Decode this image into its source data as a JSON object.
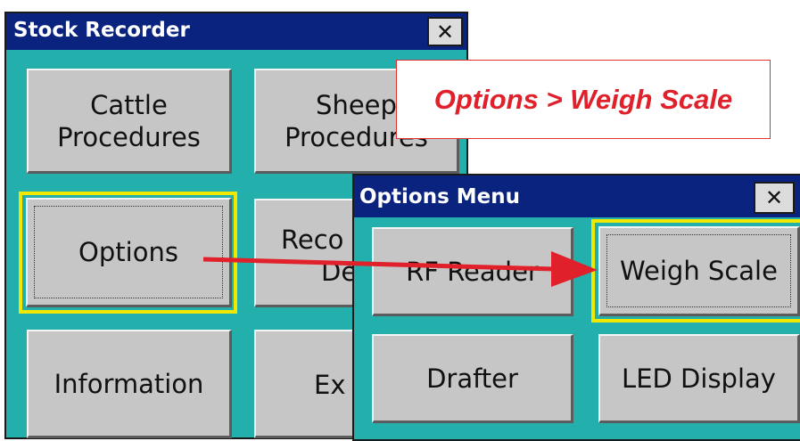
{
  "main_window": {
    "title": "Stock Recorder",
    "close_label": "✕",
    "buttons": {
      "cattle": {
        "line1": "Cattle",
        "line2": "Procedures"
      },
      "sheep": {
        "line1": "Sheep",
        "line2": "Procedures"
      },
      "options": "Options",
      "record_device": {
        "line1": "Reco",
        "line2": "Dev"
      },
      "information": "Information",
      "exit": "Ex"
    }
  },
  "options_window": {
    "title": "Options Menu",
    "close_label": "✕",
    "buttons": {
      "rf_reader": "RF Reader",
      "weigh_scale": "Weigh Scale",
      "drafter": "Drafter",
      "led_display": "LED Display"
    }
  },
  "callout": {
    "text": "Options > Weigh Scale"
  },
  "colors": {
    "titlebar": "#0a237e",
    "window_bg": "#23b0ac",
    "button_face": "#c6c6c6",
    "highlight": "#f0e800",
    "annotation_red": "#e0202a"
  },
  "icons": {
    "close": "close-icon",
    "arrow": "red-arrow-annotation"
  }
}
